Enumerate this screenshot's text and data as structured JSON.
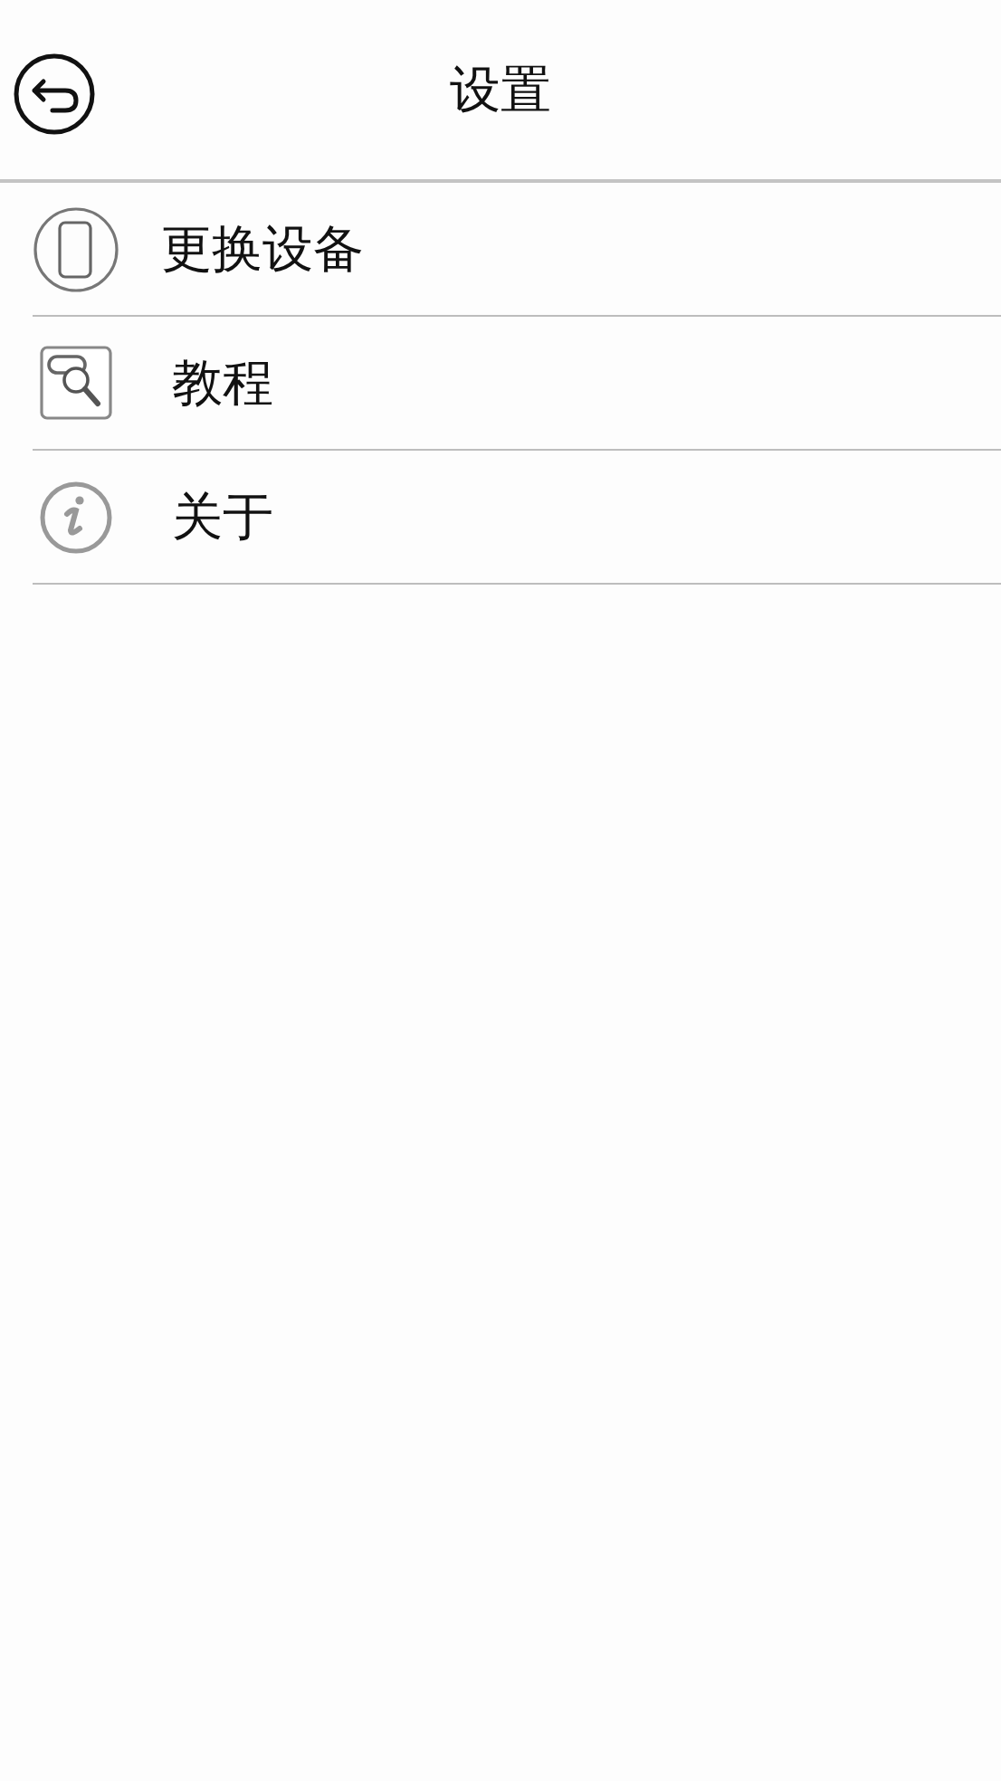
{
  "header": {
    "title": "设置"
  },
  "menu": [
    {
      "kind": "phone",
      "label": "更换设备"
    },
    {
      "kind": "tutorial",
      "label": "教程"
    },
    {
      "kind": "info",
      "label": "关于"
    }
  ]
}
